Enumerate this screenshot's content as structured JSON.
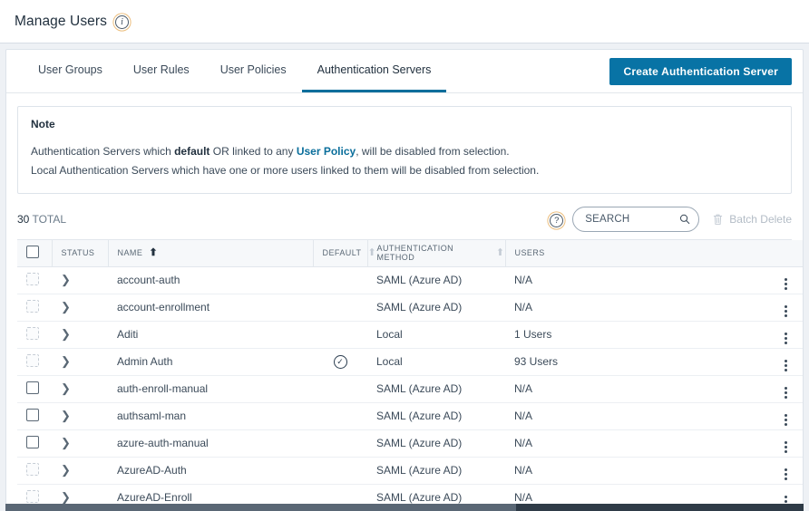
{
  "header": {
    "title": "Manage Users",
    "info_icon": "info-circle-icon"
  },
  "tabs": [
    {
      "label": "User Groups",
      "active": false
    },
    {
      "label": "User Rules",
      "active": false
    },
    {
      "label": "User Policies",
      "active": false
    },
    {
      "label": "Authentication Servers",
      "active": true
    }
  ],
  "actions": {
    "create_label": "Create Authentication Server"
  },
  "note": {
    "title": "Note",
    "line1_part1": "Authentication Servers which ",
    "line1_bold": "default",
    "line1_part2": " OR linked to any ",
    "line1_link": "User Policy",
    "line1_part3": ", will be disabled from selection.",
    "line2": "Local Authentication Servers which have one or more users linked to them will be disabled from selection."
  },
  "toolbar": {
    "total_count": "30",
    "total_label": "TOTAL",
    "help_icon": "help-circle-icon",
    "search_placeholder": "SEARCH",
    "search_value": "",
    "batch_delete_label": "Batch Delete",
    "batch_delete_enabled": false
  },
  "table": {
    "columns": [
      {
        "key": "select",
        "label": ""
      },
      {
        "key": "status",
        "label": "STATUS",
        "sort": "none"
      },
      {
        "key": "name",
        "label": "NAME",
        "sort": "asc-active"
      },
      {
        "key": "default",
        "label": "DEFAULT",
        "sort": "idle"
      },
      {
        "key": "method",
        "label": "AUTHENTICATION METHOD",
        "sort": "idle"
      },
      {
        "key": "users",
        "label": "USERS",
        "sort": "none"
      }
    ],
    "rows": [
      {
        "name": "account-auth",
        "default": false,
        "method": "SAML (Azure AD)",
        "users": "N/A",
        "selectable": false
      },
      {
        "name": "account-enrollment",
        "default": false,
        "method": "SAML (Azure AD)",
        "users": "N/A",
        "selectable": false
      },
      {
        "name": "Aditi",
        "default": false,
        "method": "Local",
        "users": "1 Users",
        "selectable": false
      },
      {
        "name": "Admin Auth",
        "default": true,
        "method": "Local",
        "users": "93 Users",
        "selectable": false
      },
      {
        "name": "auth-enroll-manual",
        "default": false,
        "method": "SAML (Azure AD)",
        "users": "N/A",
        "selectable": true
      },
      {
        "name": "authsaml-man",
        "default": false,
        "method": "SAML (Azure AD)",
        "users": "N/A",
        "selectable": true
      },
      {
        "name": "azure-auth-manual",
        "default": false,
        "method": "SAML (Azure AD)",
        "users": "N/A",
        "selectable": true
      },
      {
        "name": "AzureAD-Auth",
        "default": false,
        "method": "SAML (Azure AD)",
        "users": "N/A",
        "selectable": false
      },
      {
        "name": "AzureAD-Enroll",
        "default": false,
        "method": "SAML (Azure AD)",
        "users": "N/A",
        "selectable": false
      }
    ]
  },
  "colors": {
    "accent": "#0a6e9b",
    "button": "#0873a5",
    "text": "#3b4a59",
    "page_bg": "#eef1f5"
  }
}
